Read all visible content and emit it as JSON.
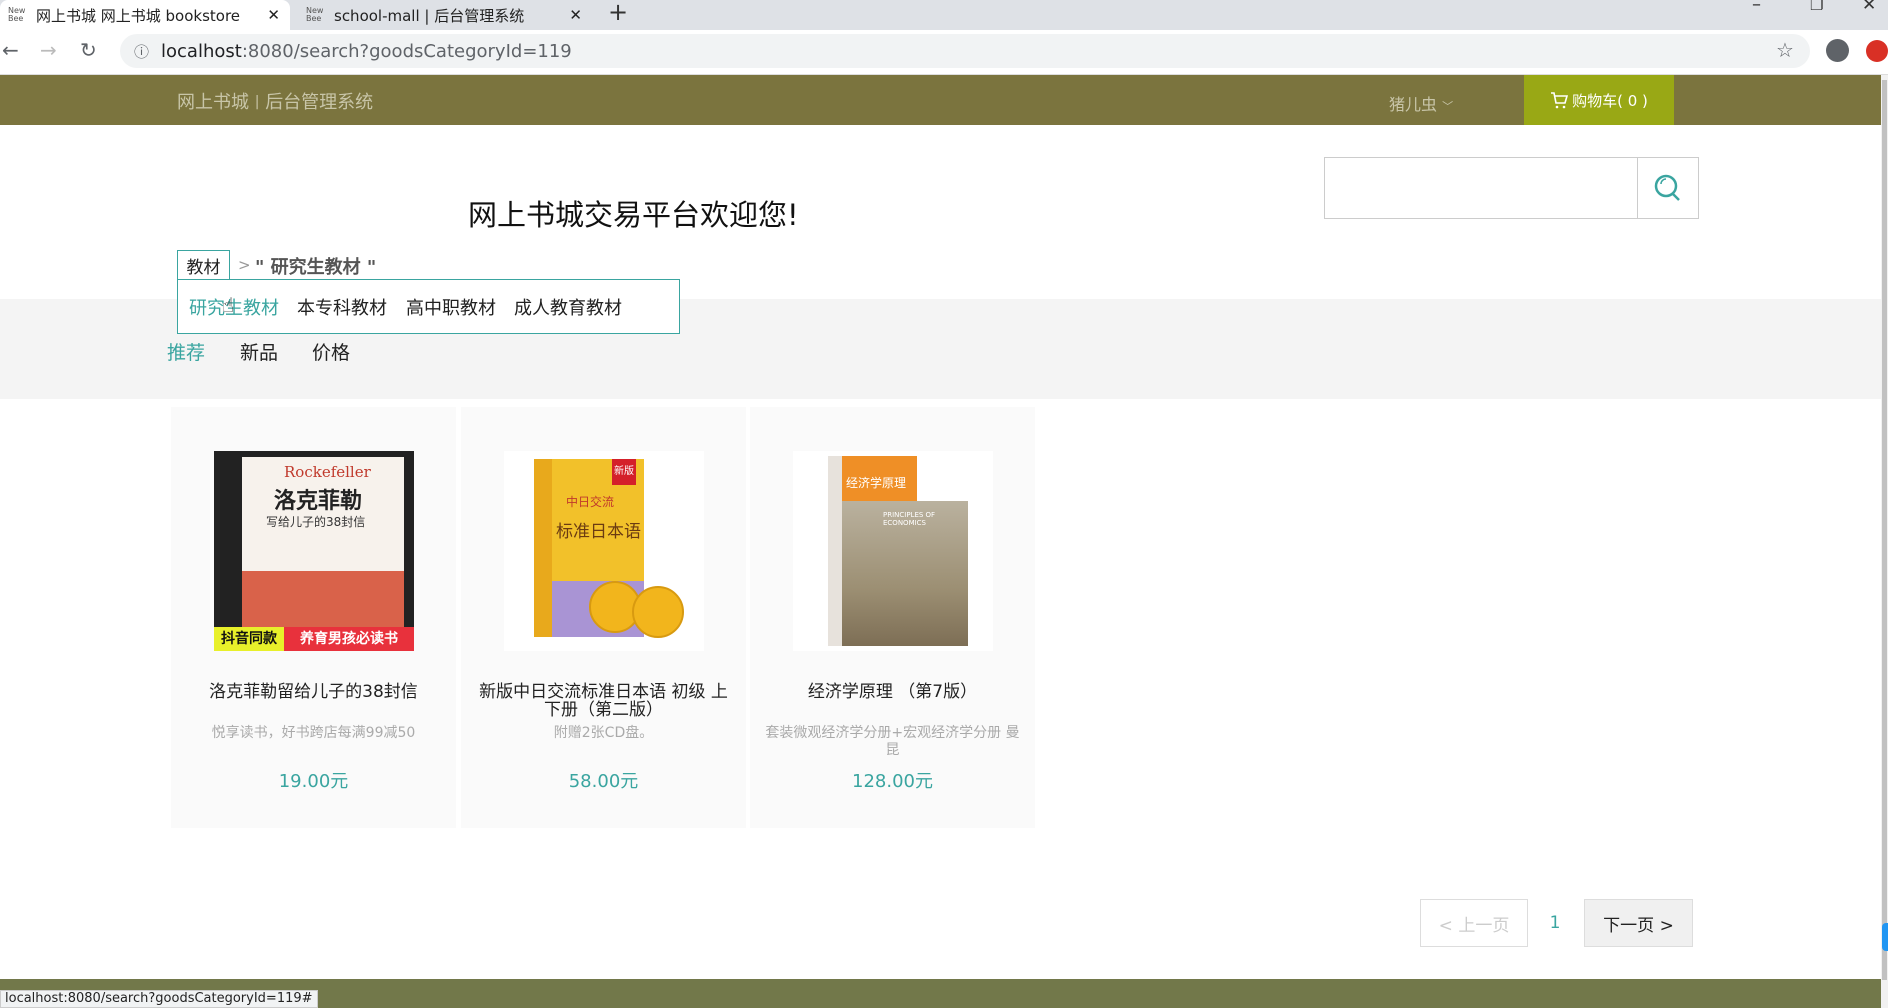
{
  "browser": {
    "tabs": [
      {
        "favicon": "New Bee",
        "title": "网上书城 网上书城 bookstore"
      },
      {
        "favicon": "New Bee",
        "title": "school-mall | 后台管理系统"
      }
    ],
    "url_host": "localhost",
    "url_path": ":8080/search?goodsCategoryId=119",
    "status_url": "localhost:8080/search?goodsCategoryId=119#"
  },
  "nav": {
    "title": "网上书城",
    "separator": "|",
    "subtitle": "后台管理系统",
    "user": "猪儿虫",
    "cart_label": "购物车( 0 )"
  },
  "header": {
    "welcome": "网上书城交易平台欢迎您!",
    "search_placeholder": ""
  },
  "breadcrumb": {
    "root": "教材",
    "separator": ">",
    "current": "\" 研究生教材 \""
  },
  "subcategories": [
    "研究生教材",
    "本专科教材",
    "高中职教材",
    "成人教育教材"
  ],
  "sort_tabs": [
    "推荐",
    "新品",
    "价格"
  ],
  "products": [
    {
      "title": "洛克菲勒留给儿子的38封信",
      "desc": "悦享读书，好书跨店每满99减50",
      "price": "19.00元",
      "cover": {
        "en": "Rockefeller",
        "zh": "洛克菲勒",
        "sub": "写给儿子的38封信",
        "tag1": "抖音同款",
        "tag2": "养育男孩必读书"
      }
    },
    {
      "title": "新版中日交流标准日本语 初级 上下册（第二版）",
      "desc": "附赠2张CD盘。",
      "price": "58.00元",
      "cover": {
        "badge": "新版",
        "zh": "中日交流",
        "main": "标准日本语"
      }
    },
    {
      "title": "经济学原理 （第7版）",
      "desc": "套装微观经济学分册+宏观经济学分册 曼昆",
      "price": "128.00元",
      "cover": {
        "zh": "经济学原理",
        "en": "PRINCIPLES OF ECONOMICS"
      }
    }
  ],
  "pagination": {
    "prev": "< 上一页",
    "current": "1",
    "next": "下一页 >"
  },
  "colors": {
    "nav": "#7b743e",
    "cart": "#99a815",
    "accent": "#3aa5a0",
    "footer": "#72784a"
  }
}
